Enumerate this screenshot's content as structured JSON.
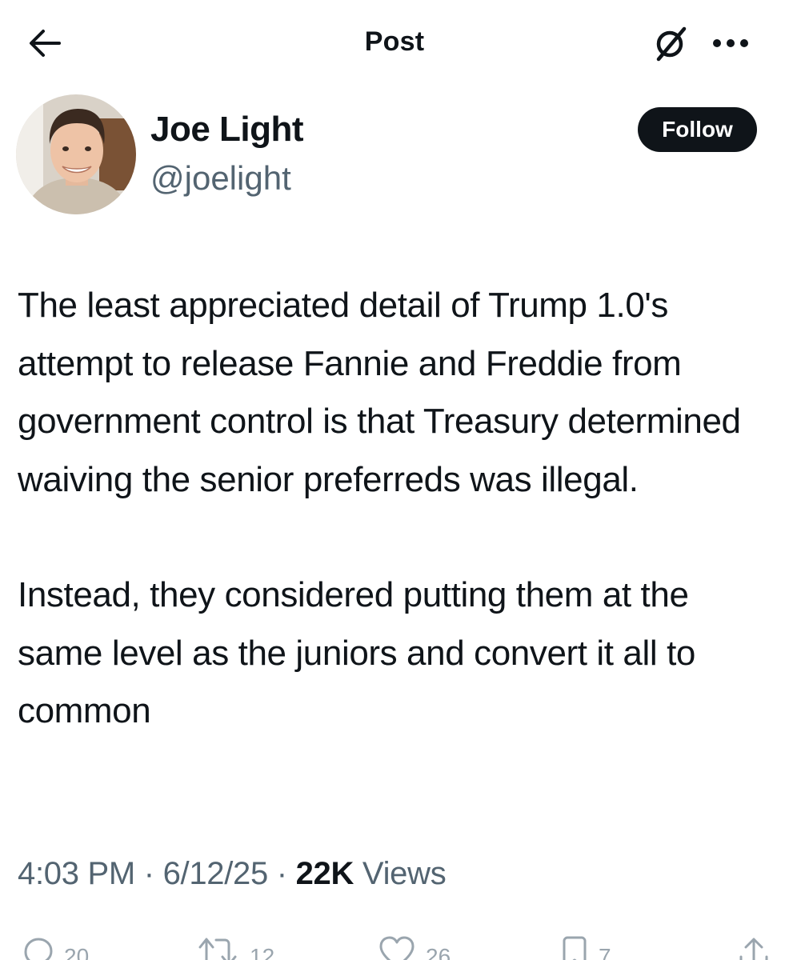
{
  "header": {
    "title": "Post",
    "back_icon": "arrow-left-icon",
    "grok_icon": "grok-slash-circle-icon",
    "more_icon": "ellipsis-icon"
  },
  "author": {
    "name": "Joe Light",
    "handle": "@joelight",
    "follow_label": "Follow"
  },
  "post": {
    "paragraphs": [
      "The least appreciated detail of Trump 1.0's attempt to release Fannie and Freddie from government control is that Treasury determined waiving the senior preferreds was illegal.",
      "Instead, they considered putting them at the same level as the juniors and convert it all to common"
    ]
  },
  "meta": {
    "time": "4:03 PM",
    "separator": "·",
    "date": "6/12/25",
    "views_count": "22K",
    "views_label": "Views"
  },
  "actions": {
    "replies": "20",
    "reposts": "12",
    "likes": "26",
    "bookmarks": "7"
  },
  "colors": {
    "text": "#0f1419",
    "secondary": "#536471",
    "button_bg": "#0f1419"
  }
}
